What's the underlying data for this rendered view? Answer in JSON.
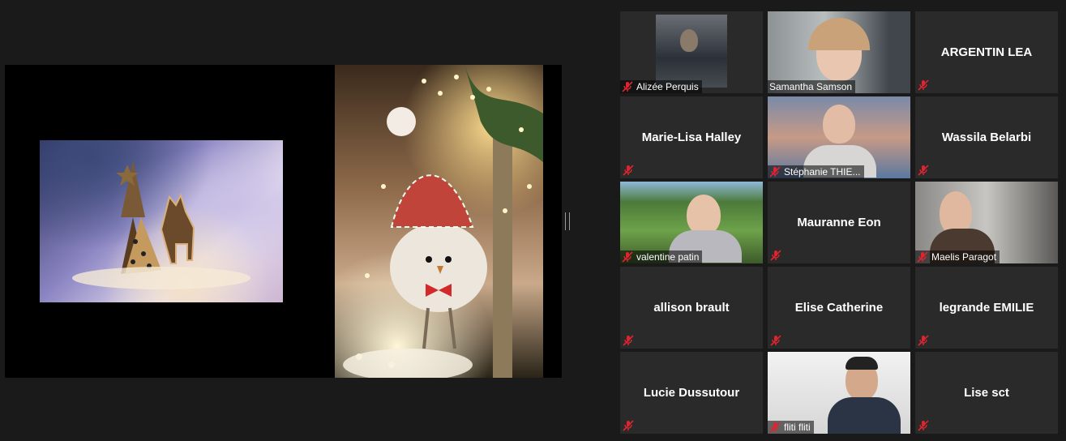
{
  "participants": [
    {
      "name": "Alizée Perquis",
      "video": true,
      "muted": true,
      "active": false
    },
    {
      "name": "Samantha Samson",
      "video": true,
      "muted": false,
      "active": true
    },
    {
      "name": "ARGENTIN LEA",
      "video": false,
      "muted": true,
      "active": false
    },
    {
      "name": "Marie-Lisa Halley",
      "video": false,
      "muted": true,
      "active": false
    },
    {
      "name": "Stéphanie THIE...",
      "video": true,
      "muted": true,
      "active": false
    },
    {
      "name": "Wassila Belarbi",
      "video": false,
      "muted": true,
      "active": false
    },
    {
      "name": "valentine patin",
      "video": true,
      "muted": true,
      "active": false
    },
    {
      "name": "Mauranne Eon",
      "video": false,
      "muted": true,
      "active": false
    },
    {
      "name": "Maelis Paragot",
      "video": true,
      "muted": true,
      "active": false
    },
    {
      "name": "allison brault",
      "video": false,
      "muted": true,
      "active": false
    },
    {
      "name": "Elise Catherine",
      "video": false,
      "muted": true,
      "active": false
    },
    {
      "name": "legrande EMILIE",
      "video": false,
      "muted": true,
      "active": false
    },
    {
      "name": "Lucie Dussutour",
      "video": false,
      "muted": true,
      "active": false
    },
    {
      "name": "fliti fliti",
      "video": true,
      "muted": true,
      "active": false
    },
    {
      "name": "Lise sct",
      "video": false,
      "muted": true,
      "active": false
    }
  ],
  "icons": {
    "muted_mic": "muted-mic-icon"
  },
  "colors": {
    "active_border": "#c6e35a",
    "muted_icon": "#e0242f",
    "tile_bg": "#2a2a2a"
  }
}
